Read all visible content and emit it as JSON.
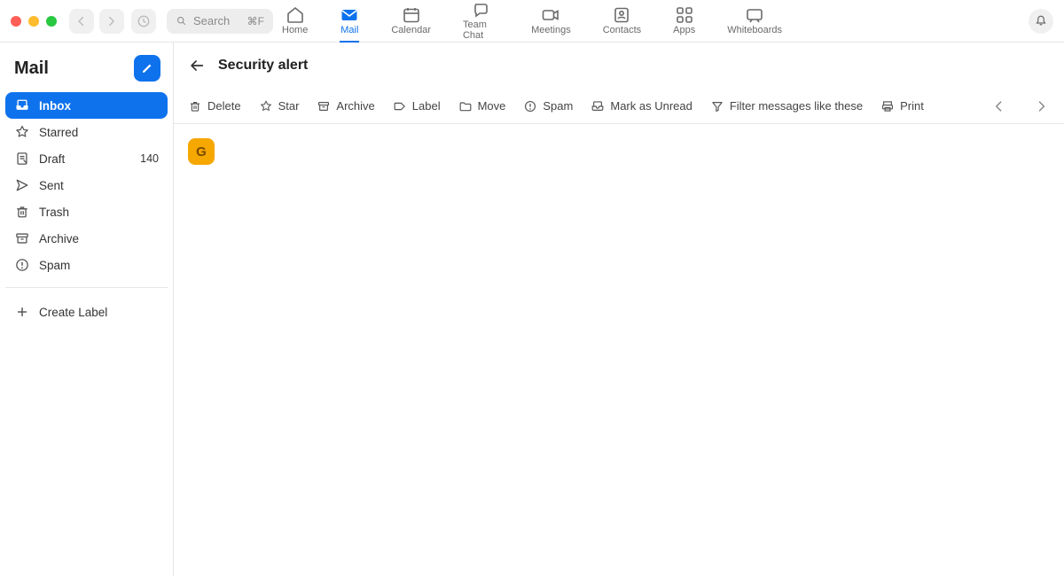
{
  "search": {
    "placeholder": "Search",
    "shortcut": "⌘F"
  },
  "topnav": {
    "items": [
      {
        "label": "Home",
        "icon": "home",
        "active": false
      },
      {
        "label": "Mail",
        "icon": "mail",
        "active": true
      },
      {
        "label": "Calendar",
        "icon": "calendar",
        "active": false
      },
      {
        "label": "Team Chat",
        "icon": "chat",
        "active": false
      },
      {
        "label": "Meetings",
        "icon": "video",
        "active": false
      },
      {
        "label": "Contacts",
        "icon": "contact",
        "active": false
      },
      {
        "label": "Apps",
        "icon": "apps",
        "active": false
      },
      {
        "label": "Whiteboards",
        "icon": "whiteboard",
        "active": false
      }
    ]
  },
  "sidebar": {
    "title": "Mail",
    "items": [
      {
        "label": "Inbox",
        "icon": "tray",
        "active": true,
        "count": ""
      },
      {
        "label": "Starred",
        "icon": "star",
        "active": false,
        "count": ""
      },
      {
        "label": "Draft",
        "icon": "draft",
        "active": false,
        "count": "140"
      },
      {
        "label": "Sent",
        "icon": "send",
        "active": false,
        "count": ""
      },
      {
        "label": "Trash",
        "icon": "trash",
        "active": false,
        "count": ""
      },
      {
        "label": "Archive",
        "icon": "archive",
        "active": false,
        "count": ""
      },
      {
        "label": "Spam",
        "icon": "spam",
        "active": false,
        "count": ""
      }
    ],
    "create_label": "Create Label"
  },
  "mail": {
    "subject": "Security alert",
    "toolbar": {
      "delete": "Delete",
      "star": "Star",
      "archive": "Archive",
      "label": "Label",
      "move": "Move",
      "spam": "Spam",
      "unread": "Mark as Unread",
      "filter": "Filter messages like these",
      "print": "Print"
    },
    "sender_initial": "G"
  },
  "colors": {
    "accent": "#0e72ed",
    "avatar_bg": "#f6a700"
  }
}
